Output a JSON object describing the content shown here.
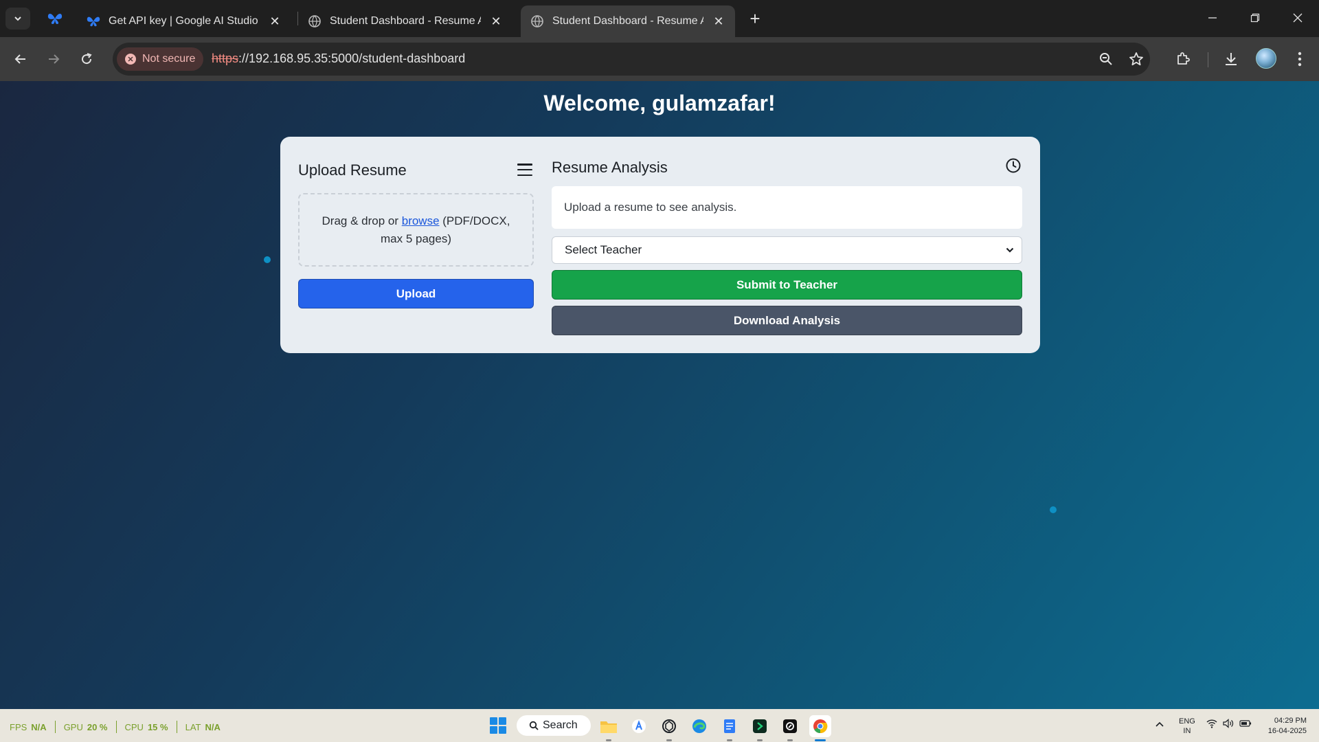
{
  "browser": {
    "tabs": [
      {
        "title": "Get API key | Google AI Studio",
        "close": "✕"
      },
      {
        "title": "Student Dashboard - Resume Analyzer",
        "close": "✕"
      },
      {
        "title": "Student Dashboard - Resume Analyzer",
        "close": "✕"
      }
    ],
    "new_tab": "+",
    "security_label": "Not secure",
    "url_scheme": "https",
    "url_rest": "://192.168.95.35:5000/student-dashboard"
  },
  "page": {
    "welcome": "Welcome, gulamzafar!",
    "upload_panel": {
      "title": "Upload Resume",
      "drop_text_before": "Drag & drop or ",
      "browse_link": "browse",
      "drop_text_after": " (PDF/DOCX, max 5 pages)",
      "upload_button": "Upload"
    },
    "analysis_panel": {
      "title": "Resume Analysis",
      "placeholder": "Upload a resume to see analysis.",
      "select_teacher": "Select Teacher",
      "submit_button": "Submit to Teacher",
      "download_button": "Download Analysis"
    }
  },
  "taskbar": {
    "perf": {
      "fps_label": "FPS",
      "fps_value": "N/A",
      "gpu_label": "GPU",
      "gpu_value": "20 %",
      "cpu_label": "CPU",
      "cpu_value": "15 %",
      "lat_label": "LAT",
      "lat_value": "N/A"
    },
    "search_label": "Search",
    "lang_top": "ENG",
    "lang_bottom": "IN",
    "time": "04:29 PM",
    "date": "16-04-2025"
  },
  "colors": {
    "upload_button": "#2563eb",
    "submit_button": "#16a34a",
    "download_button": "#4a5568",
    "not_secure": "#f28b82"
  }
}
